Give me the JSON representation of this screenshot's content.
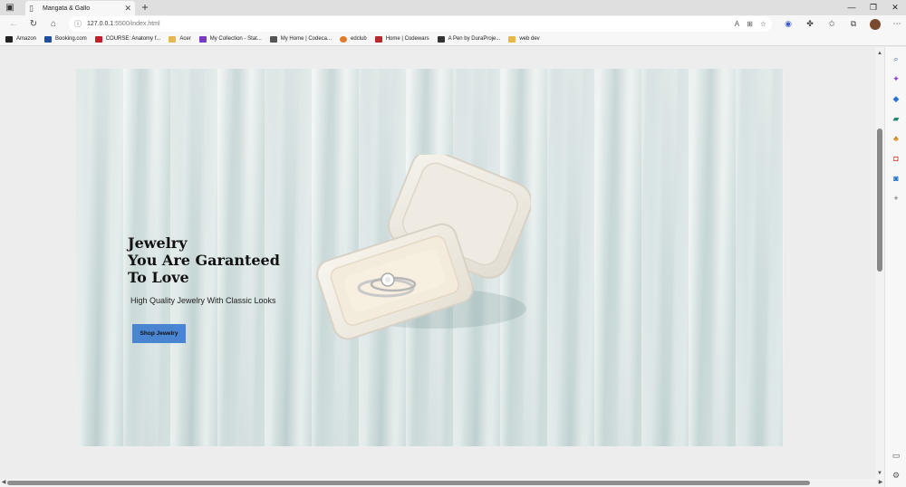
{
  "browser": {
    "tab": {
      "title": "Mangata & Gallo",
      "close": "✕"
    },
    "new_tab": "+",
    "window_controls": {
      "minimize": "—",
      "maximize": "❐",
      "close": "✕"
    },
    "nav": {
      "back": "←",
      "reload": "↻",
      "home": "⌂"
    },
    "address": {
      "info_icon": "ⓘ",
      "host": "127.0.0.1",
      "path": ":5500/index.html"
    },
    "bookmarks": [
      {
        "label": "Amazon",
        "color": "#222222"
      },
      {
        "label": "Booking.com",
        "color": "#1f4fa0"
      },
      {
        "label": "COURSE: Anatomy f...",
        "color": "#c0202a"
      },
      {
        "label": "Acer",
        "color": "#e6b84a"
      },
      {
        "label": "My Collection - Stat...",
        "color": "#7a3ac2"
      },
      {
        "label": "My Home | Codeca...",
        "color": "#555555"
      },
      {
        "label": "edclub",
        "color": "#e07a2c"
      },
      {
        "label": "Home | Codewars",
        "color": "#b32c2c"
      },
      {
        "label": "A Pen by DuraProje...",
        "color": "#333333"
      },
      {
        "label": "web dev",
        "color": "#e6b84a"
      }
    ]
  },
  "hero": {
    "heading_line1": "Jewelry",
    "heading_line2": "You Are Garanteed",
    "heading_line3": "To Love",
    "subtitle": "High Quality Jewelry With Classic Looks",
    "button": "Shop Jewelry"
  },
  "colors": {
    "button": "#4a85d1",
    "backdrop": "#d5e2e2",
    "page_bg": "#eeeded"
  }
}
